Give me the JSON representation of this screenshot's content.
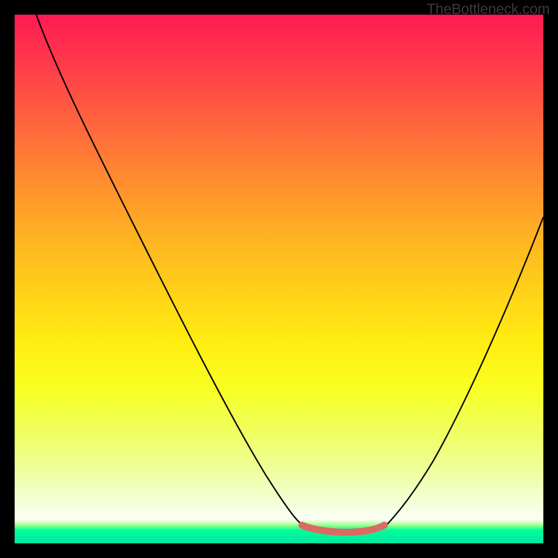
{
  "watermark": "TheBottleneck.com",
  "chart_data": {
    "type": "line",
    "title": "",
    "xlabel": "",
    "ylabel": "",
    "xlim": [
      0,
      100
    ],
    "ylim": [
      0,
      100
    ],
    "series": [
      {
        "name": "left-curve",
        "x": [
          4,
          10,
          18,
          26,
          34,
          42,
          48,
          53,
          56
        ],
        "y": [
          100,
          86,
          69,
          52,
          35,
          18,
          7,
          2,
          1
        ]
      },
      {
        "name": "right-curve",
        "x": [
          69,
          74,
          80,
          86,
          92,
          98,
          100
        ],
        "y": [
          1,
          4,
          13,
          26,
          42,
          58,
          64
        ]
      },
      {
        "name": "bottom-band",
        "x": [
          53,
          56,
          60,
          64,
          67,
          69
        ],
        "y": [
          2.6,
          2.2,
          2.0,
          2.0,
          2.2,
          2.6
        ]
      }
    ],
    "colors": {
      "curve": "#000000",
      "band": "#db6a63"
    }
  }
}
